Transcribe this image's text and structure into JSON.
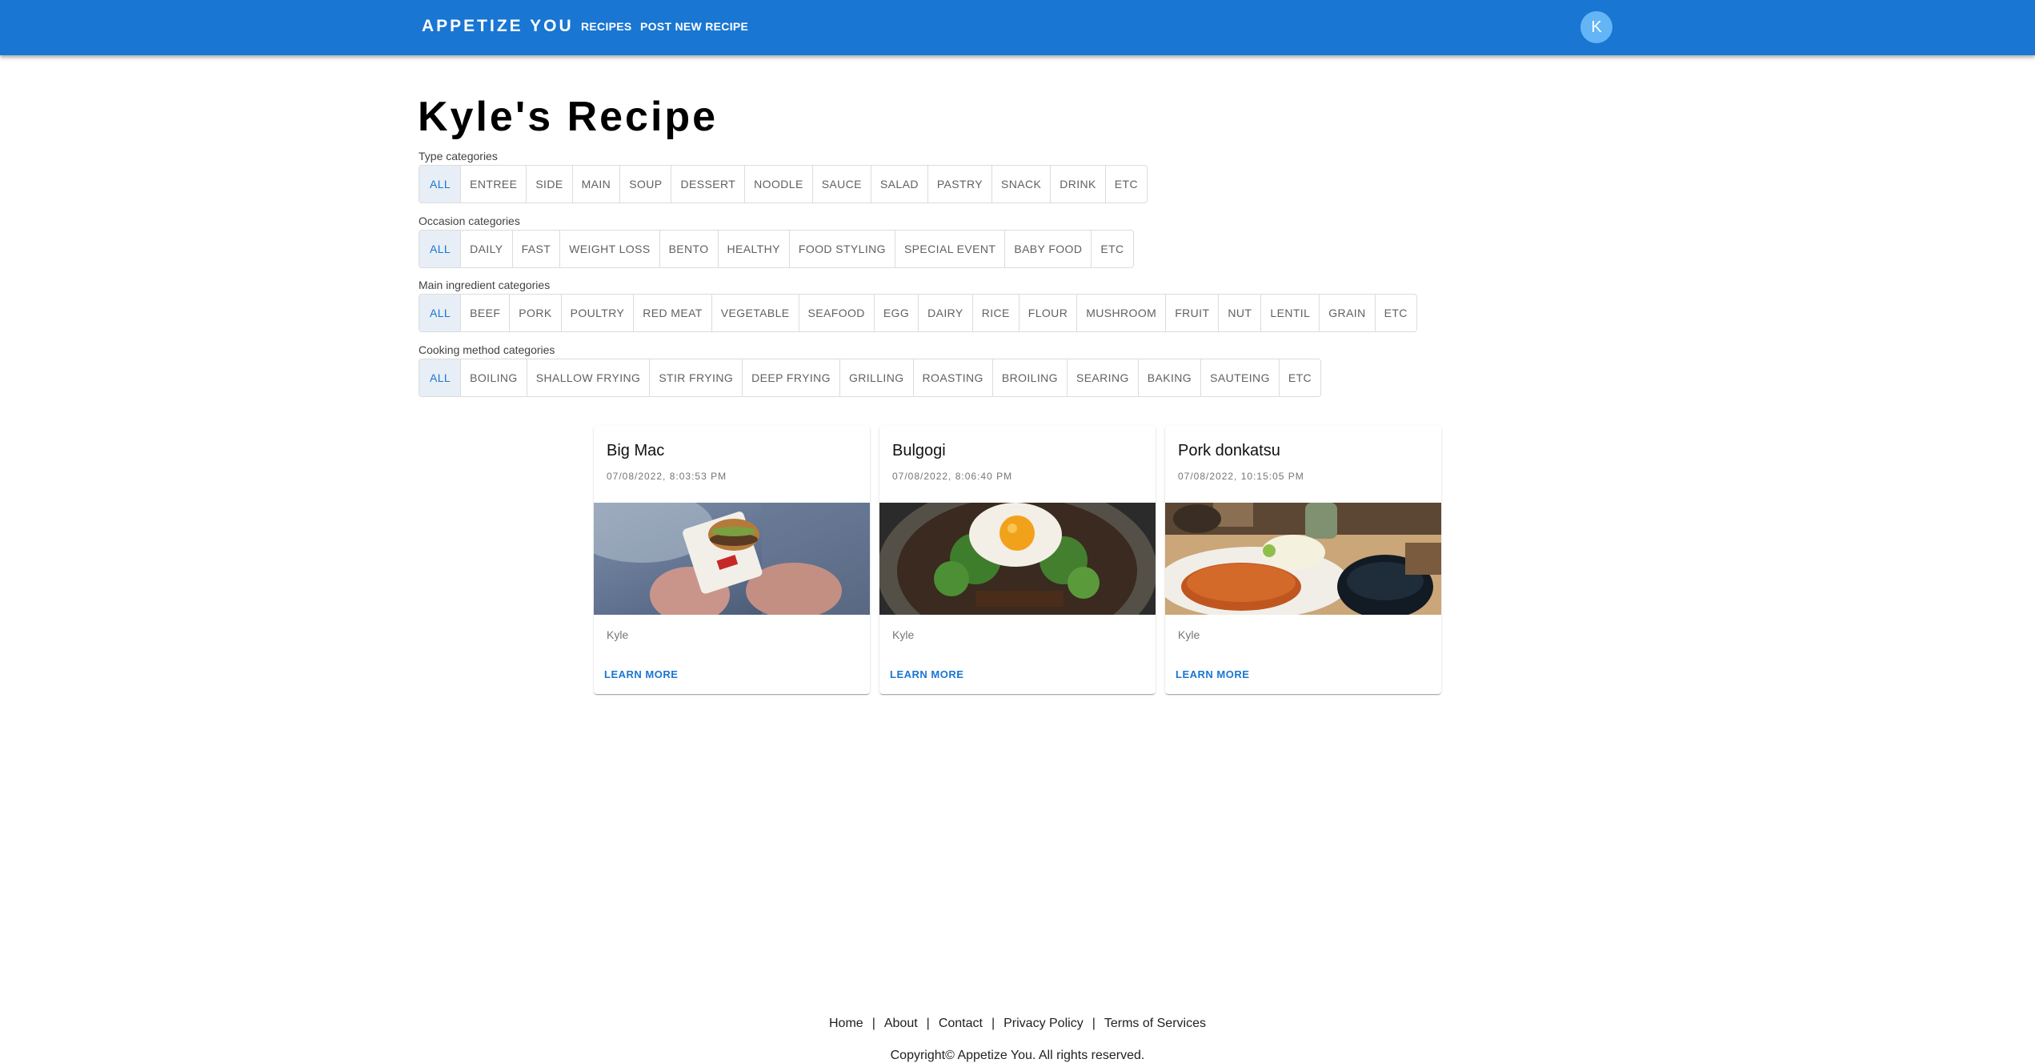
{
  "appbar": {
    "brand": "APPETIZE YOU",
    "nav": [
      {
        "label": "RECIPES"
      },
      {
        "label": "POST NEW RECIPE"
      }
    ],
    "avatar_initial": "K",
    "color": "#1976d2"
  },
  "page": {
    "title": "Kyle's Recipe"
  },
  "categories": [
    {
      "label": "Type categories",
      "selected": "ALL",
      "options": [
        "ALL",
        "ENTREE",
        "SIDE",
        "MAIN",
        "SOUP",
        "DESSERT",
        "NOODLE",
        "SAUCE",
        "SALAD",
        "PASTRY",
        "SNACK",
        "DRINK",
        "ETC"
      ]
    },
    {
      "label": "Occasion categories",
      "selected": "ALL",
      "options": [
        "ALL",
        "DAILY",
        "FAST",
        "WEIGHT LOSS",
        "BENTO",
        "HEALTHY",
        "FOOD STYLING",
        "SPECIAL EVENT",
        "BABY FOOD",
        "ETC"
      ]
    },
    {
      "label": "Main ingredient categories",
      "selected": "ALL",
      "options": [
        "ALL",
        "BEEF",
        "PORK",
        "POULTRY",
        "RED MEAT",
        "VEGETABLE",
        "SEAFOOD",
        "EGG",
        "DAIRY",
        "RICE",
        "FLOUR",
        "MUSHROOM",
        "FRUIT",
        "NUT",
        "LENTIL",
        "GRAIN",
        "ETC"
      ]
    },
    {
      "label": "Cooking method categories",
      "selected": "ALL",
      "options": [
        "ALL",
        "BOILING",
        "SHALLOW FRYING",
        "STIR FRYING",
        "DEEP FRYING",
        "GRILLING",
        "ROASTING",
        "BROILING",
        "SEARING",
        "BAKING",
        "SAUTEING",
        "ETC"
      ]
    }
  ],
  "recipes": [
    {
      "title": "Big Mac",
      "date": "07/08/2022, 8:03:53 PM",
      "author": "Kyle",
      "action": "LEARN MORE",
      "image": "burger-photo"
    },
    {
      "title": "Bulgogi",
      "date": "07/08/2022, 8:06:40 PM",
      "author": "Kyle",
      "action": "LEARN MORE",
      "image": "bibimbap-photo"
    },
    {
      "title": "Pork donkatsu",
      "date": "07/08/2022, 10:15:05 PM",
      "author": "Kyle",
      "action": "LEARN MORE",
      "image": "donkatsu-photo"
    }
  ],
  "footer": {
    "links": [
      "Home",
      "About",
      "Contact",
      "Privacy Policy",
      "Terms of Services"
    ],
    "separator": "|",
    "copyright": "Copyright© Appetize You. All rights reserved."
  }
}
